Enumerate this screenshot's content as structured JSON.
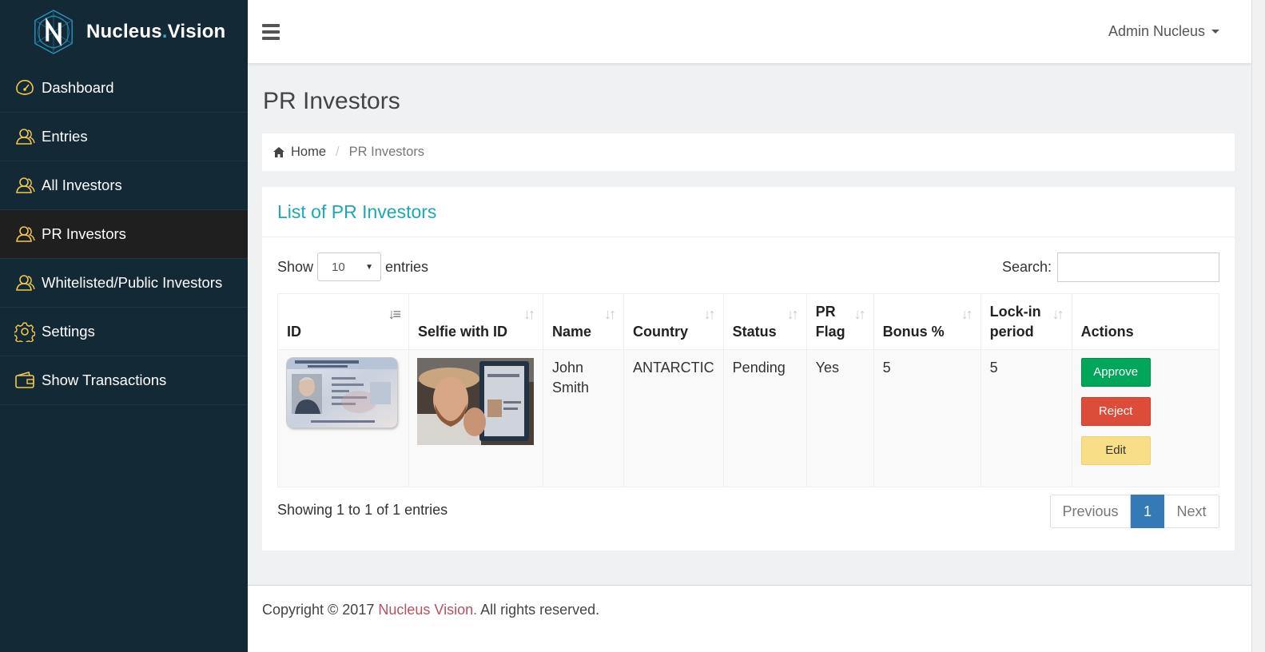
{
  "brand": {
    "name_part1": "Nucleus",
    "name_dot": ".",
    "name_part2": "Vision"
  },
  "sidebar": {
    "items": [
      {
        "label": "Dashboard",
        "icon": "dashboard-icon"
      },
      {
        "label": "Entries",
        "icon": "users-icon"
      },
      {
        "label": "All Investors",
        "icon": "users-icon"
      },
      {
        "label": "PR Investors",
        "icon": "users-icon",
        "active": true
      },
      {
        "label": "Whitelisted/Public Investors",
        "icon": "users-icon"
      },
      {
        "label": "Settings",
        "icon": "gear-icon"
      },
      {
        "label": "Show Transactions",
        "icon": "wallet-icon"
      }
    ]
  },
  "topbar": {
    "user": "Admin Nucleus"
  },
  "page": {
    "title": "PR Investors"
  },
  "breadcrumb": {
    "home": "Home",
    "current": "PR Investors"
  },
  "panel": {
    "title": "List of PR Investors"
  },
  "table_controls": {
    "show": "Show",
    "length_value": "10",
    "entries": "entries",
    "search_label": "Search:",
    "search_value": ""
  },
  "table": {
    "headers": [
      "ID",
      "Selfie with ID",
      "Name",
      "Country",
      "Status",
      "PR Flag",
      "Bonus %",
      "Lock-in period",
      "Actions"
    ],
    "rows": [
      {
        "name": "John Smith",
        "country": "ANTARCTIC",
        "status": "Pending",
        "pr_flag": "Yes",
        "bonus": "5",
        "lockin": "5",
        "actions": {
          "approve": "Approve",
          "reject": "Reject",
          "edit": "Edit"
        }
      }
    ]
  },
  "pagination": {
    "info": "Showing 1 to 1 of 1 entries",
    "previous": "Previous",
    "page": "1",
    "next": "Next"
  },
  "footer": {
    "prefix": "Copyright © 2017",
    "link": "Nucleus Vision.",
    "suffix": "All rights reserved."
  },
  "colors": {
    "sidebar": "#142936",
    "accent": "#1ca8b6",
    "icon": "#f2c94c",
    "approve": "#00a65a",
    "reject": "#dd4b39",
    "edit": "#f9de88",
    "page_active": "#337ab7"
  }
}
